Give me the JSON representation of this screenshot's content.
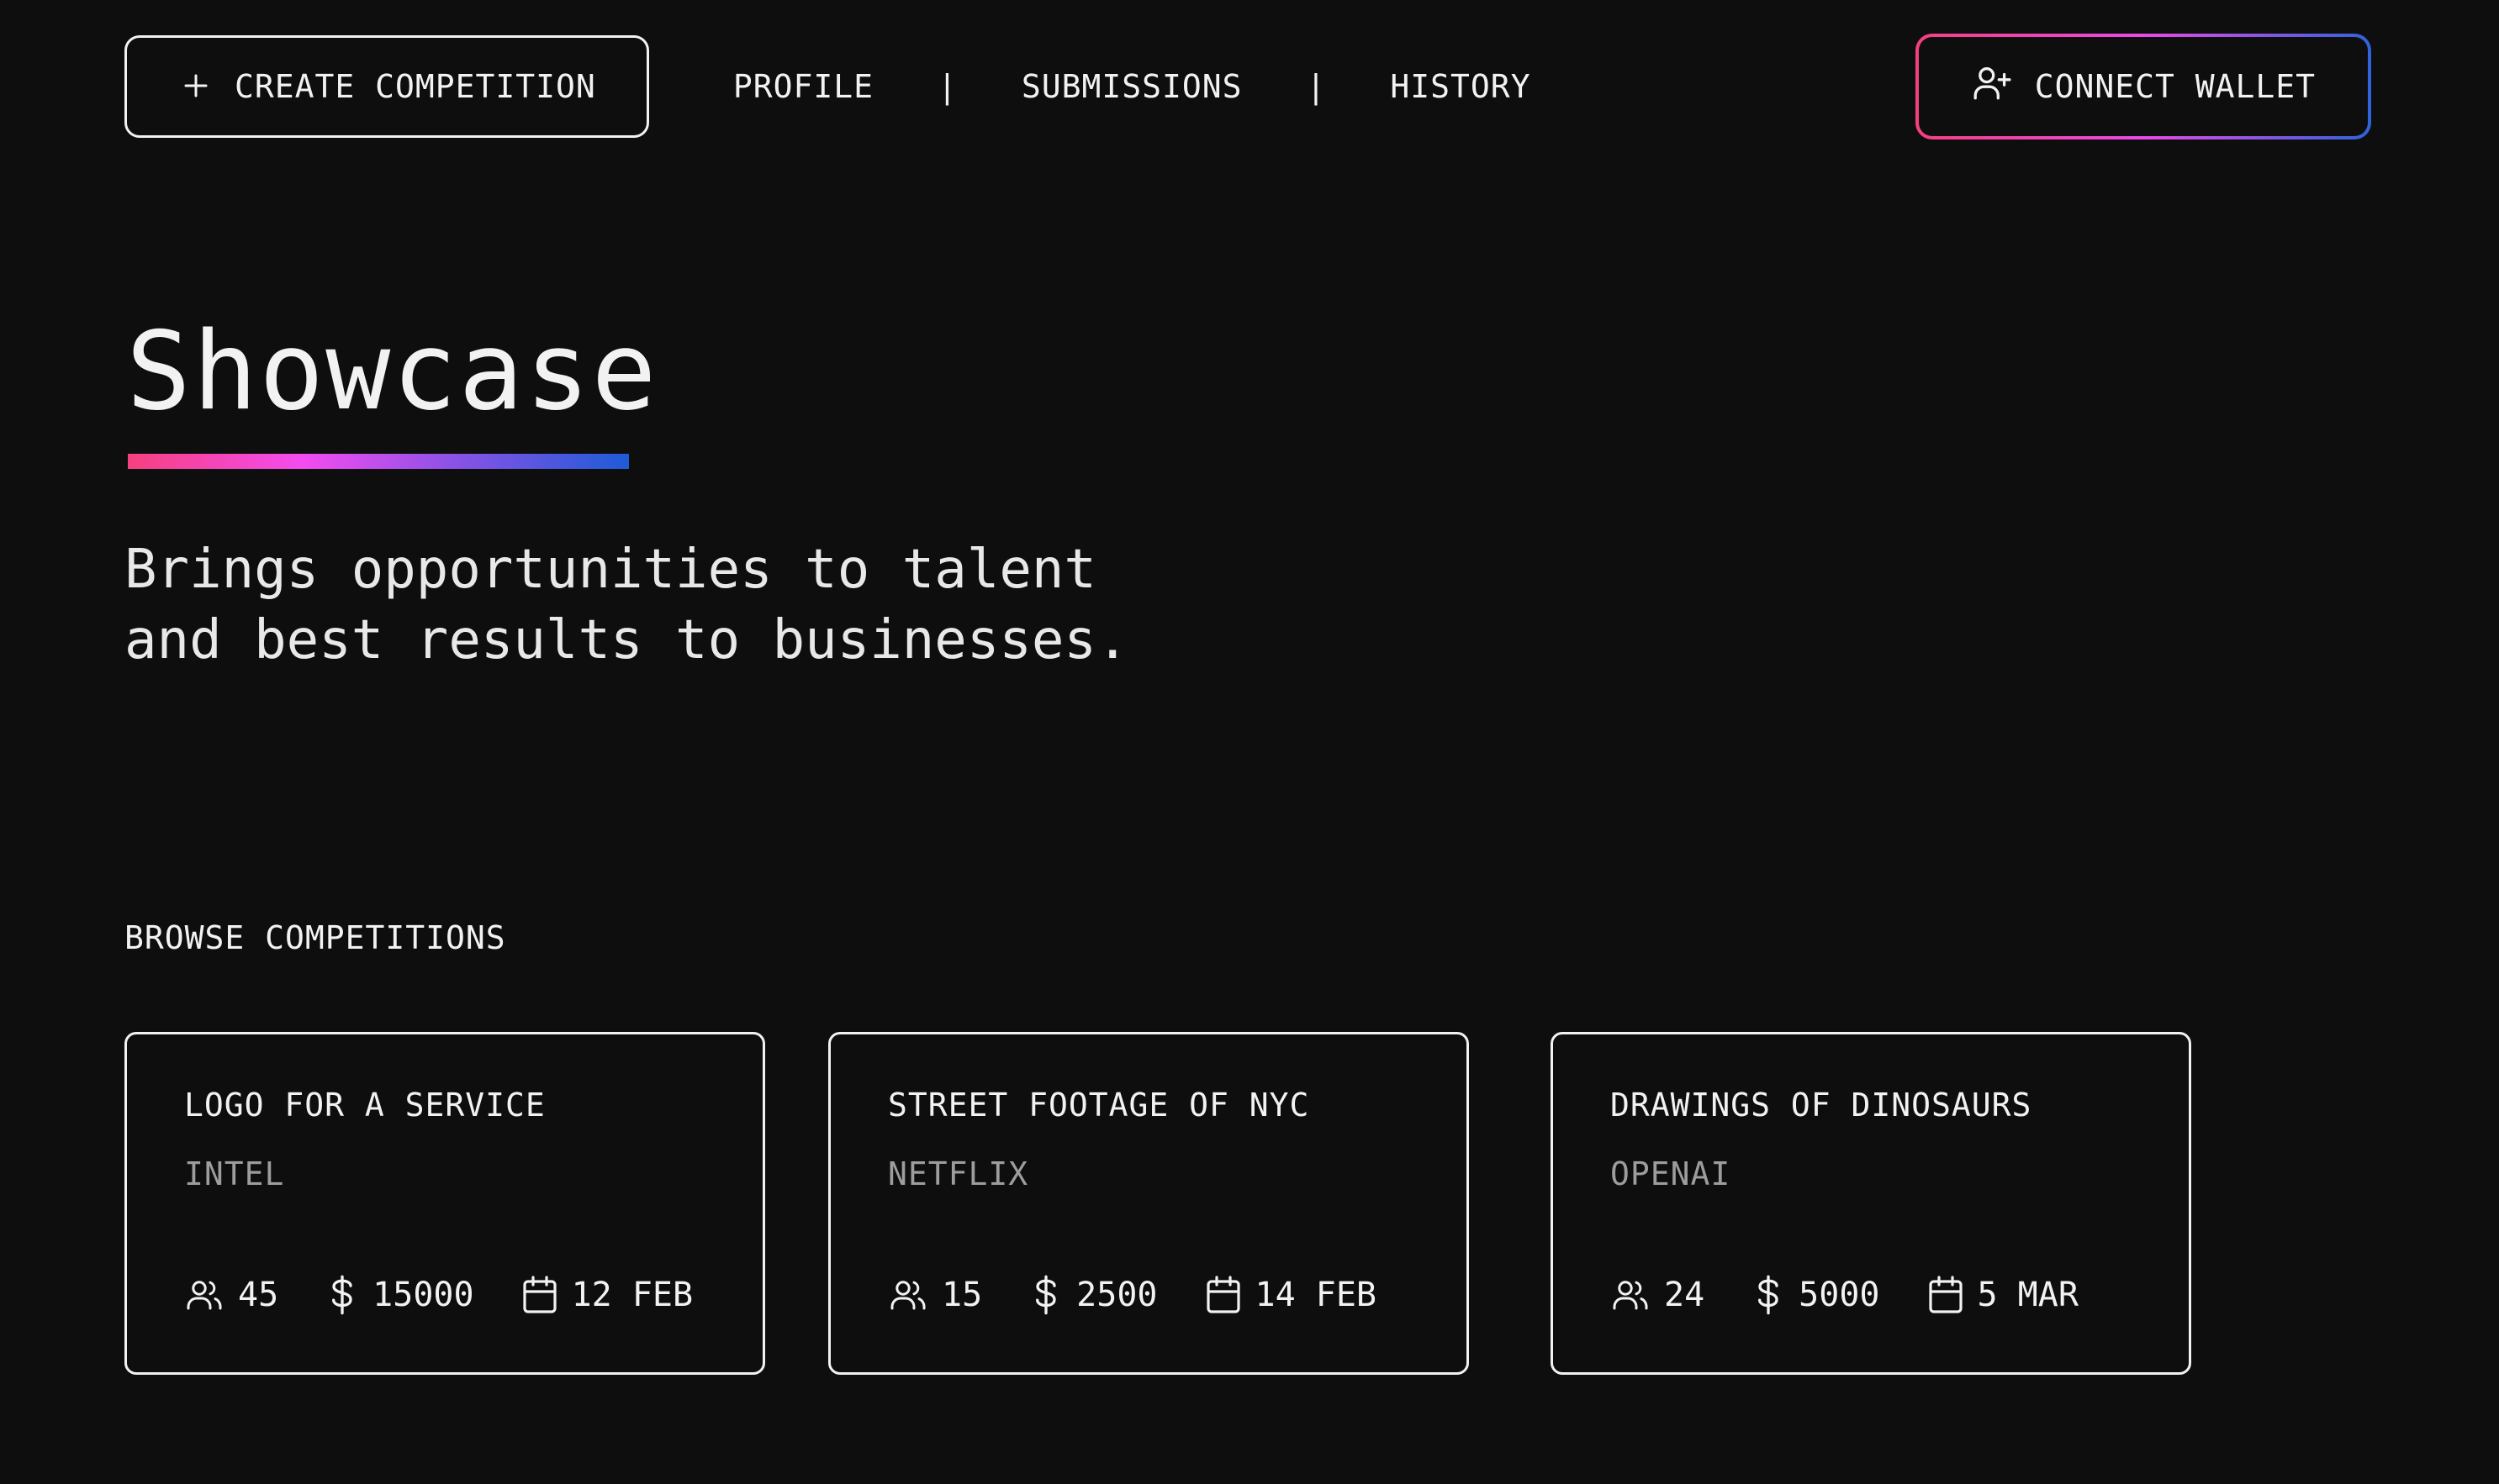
{
  "nav": {
    "create_label": "CREATE COMPETITION",
    "links": [
      "PROFILE",
      "SUBMISSIONS",
      "HISTORY"
    ],
    "separator": "|",
    "wallet_label": "CONNECT WALLET"
  },
  "hero": {
    "title": "Showcase",
    "subtitle_line1": "Brings opportunities to talent",
    "subtitle_line2": "and best results to businesses."
  },
  "browse": {
    "title": "BROWSE COMPETITIONS",
    "cards": [
      {
        "title": "LOGO FOR A SERVICE",
        "company": "INTEL",
        "participants": "45",
        "reward": "15000",
        "date": "12 FEB"
      },
      {
        "title": "STREET FOOTAGE OF NYC",
        "company": "NETFLIX",
        "participants": "15",
        "reward": "2500",
        "date": "14 FEB"
      },
      {
        "title": "DRAWINGS OF DINOSAURS",
        "company": "OPENAI",
        "participants": "24",
        "reward": "5000",
        "date": "5 MAR"
      }
    ]
  },
  "icons": {
    "create": "plus-icon",
    "wallet": "user-plus-icon",
    "participants": "users-icon",
    "reward": "dollar-icon",
    "date": "calendar-icon"
  },
  "colors": {
    "background": "#0e0e0e",
    "text": "#f2f2f2",
    "muted": "#9d9d9d",
    "gradient_start": "#f5407f",
    "gradient_mid": "#f44cf0",
    "gradient_end": "#1e5bd8"
  }
}
